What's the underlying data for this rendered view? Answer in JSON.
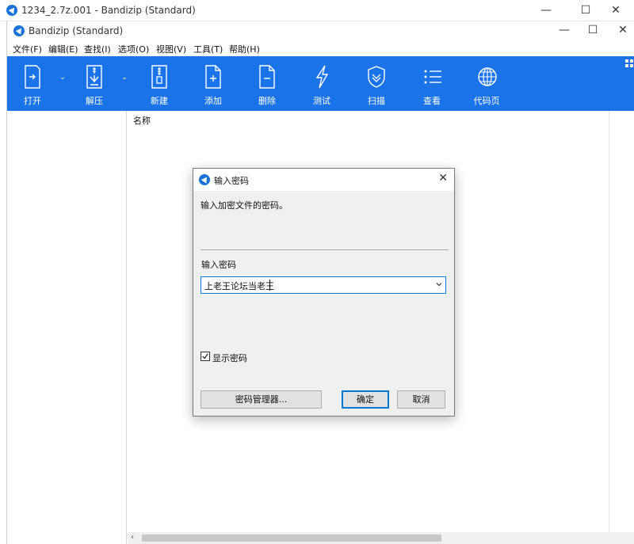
{
  "outer_window": {
    "title": "1234_2.7z.001 - Bandizip (Standard)",
    "min_glyph": "—",
    "max_glyph": "☐",
    "close_glyph": "✕"
  },
  "app_window": {
    "title": "Bandizip (Standard)",
    "min_glyph": "—",
    "max_glyph": "☐",
    "close_glyph": "✕"
  },
  "menu": {
    "items": [
      "文件(F)",
      "编辑(E)",
      "查找(I)",
      "选项(O)",
      "视图(V)",
      "工具(T)",
      "帮助(H)"
    ]
  },
  "toolbar": {
    "bg_color": "#1a73e8",
    "items": [
      {
        "label": "打开",
        "icon": "open-icon"
      },
      {
        "label": "解压",
        "icon": "extract-icon"
      },
      {
        "label": "新建",
        "icon": "new-archive-icon"
      },
      {
        "label": "添加",
        "icon": "add-file-icon"
      },
      {
        "label": "删除",
        "icon": "delete-file-icon"
      },
      {
        "label": "测试",
        "icon": "test-icon"
      },
      {
        "label": "扫描",
        "icon": "scan-shield-icon"
      },
      {
        "label": "查看",
        "icon": "view-list-icon"
      },
      {
        "label": "代码页",
        "icon": "codepage-globe-icon"
      }
    ],
    "dropdown_glyph": "⌄"
  },
  "file_list": {
    "column_name": "名称"
  },
  "dialog": {
    "title": "输入密码",
    "close_glyph": "✕",
    "description": "输入加密文件的密码。",
    "field_label": "输入密码",
    "password_value": "上老王论坛当老王",
    "show_password_label": "显示密码",
    "show_password_checked": true,
    "password_manager_button": "密码管理器...",
    "ok_button": "确定",
    "cancel_button": "取消"
  },
  "accent_color": "#0078d7"
}
